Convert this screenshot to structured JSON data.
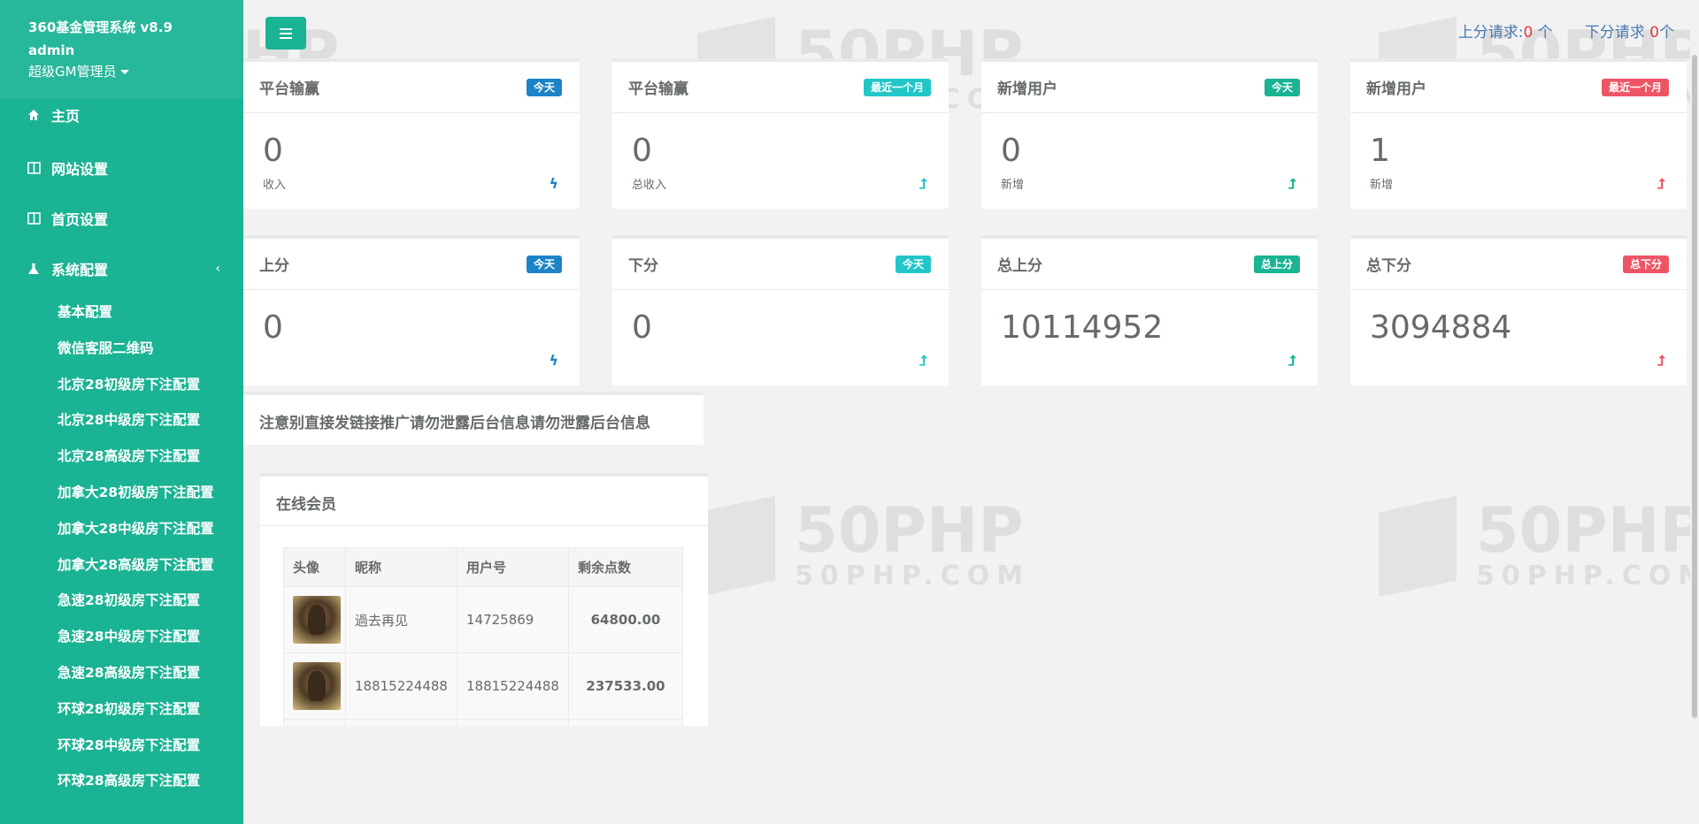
{
  "sidebar": {
    "app_title": "360基金管理系统 v8.9",
    "user": "admin",
    "role": "超级GM管理员",
    "nav": [
      {
        "label": "主页"
      },
      {
        "label": "网站设置"
      },
      {
        "label": "首页设置"
      },
      {
        "label": "系统配置",
        "chevron": "‹"
      }
    ],
    "sub_items": [
      "基本配置",
      "微信客服二维码",
      "北京28初级房下注配置",
      "北京28中级房下注配置",
      "北京28高级房下注配置",
      "加拿大28初级房下注配置",
      "加拿大28中级房下注配置",
      "加拿大28高级房下注配置",
      "急速28初级房下注配置",
      "急速28中级房下注配置",
      "急速28高级房下注配置",
      "环球28初级房下注配置",
      "环球28中级房下注配置",
      "环球28高级房下注配置"
    ]
  },
  "topbar": {
    "up_label": "上分请求:",
    "up_count": "0",
    "up_unit": " 个",
    "down_label": "下分请求 ",
    "down_count": "0",
    "down_unit": "个"
  },
  "cards": [
    {
      "title": "平台输赢",
      "badge": "今天",
      "badge_color": "#1c84c6",
      "value": "0",
      "sub": "收入",
      "icon": "ϟ",
      "icon_color": "#1c84c6"
    },
    {
      "title": "平台输赢",
      "badge": "最近一个月",
      "badge_color": "#23c6c8",
      "value": "0",
      "sub": "总收入",
      "icon": "⮥",
      "icon_color": "#23c6c8"
    },
    {
      "title": "新增用户",
      "badge": "今天",
      "badge_color": "#1ab394",
      "value": "0",
      "sub": "新增",
      "icon": "⮥",
      "icon_color": "#1ab394"
    },
    {
      "title": "新增用户",
      "badge": "最近一个月",
      "badge_color": "#ed5565",
      "value": "1",
      "sub": "新增",
      "icon": "⮥",
      "icon_color": "#ed5565"
    },
    {
      "title": "上分",
      "badge": "今天",
      "badge_color": "#1c84c6",
      "value": "0",
      "sub": "",
      "icon": "ϟ",
      "icon_color": "#1c84c6"
    },
    {
      "title": "下分",
      "badge": "今天",
      "badge_color": "#23c6c8",
      "value": "0",
      "sub": "",
      "icon": "⮥",
      "icon_color": "#23c6c8"
    },
    {
      "title": "总上分",
      "badge": "总上分",
      "badge_color": "#1ab394",
      "value": "10114952",
      "sub": "",
      "icon": "⮥",
      "icon_color": "#1ab394"
    },
    {
      "title": "总下分",
      "badge": "总下分",
      "badge_color": "#ed5565",
      "value": "3094884",
      "sub": "",
      "icon": "⮥",
      "icon_color": "#ed5565"
    }
  ],
  "notice": "注意别直接发链接推广请勿泄露后台信息请勿泄露后台信息",
  "online": {
    "title": "在线会员",
    "columns": [
      "头像",
      "昵称",
      "用户号",
      "剩余点数"
    ],
    "rows": [
      {
        "nickname": "過去再见",
        "user_id": "14725869",
        "points": "64800.00"
      },
      {
        "nickname": "18815224488",
        "user_id": "18815224488",
        "points": "237533.00"
      }
    ]
  },
  "watermark": {
    "big": "50PHP",
    "small": "50PHP.COM"
  }
}
